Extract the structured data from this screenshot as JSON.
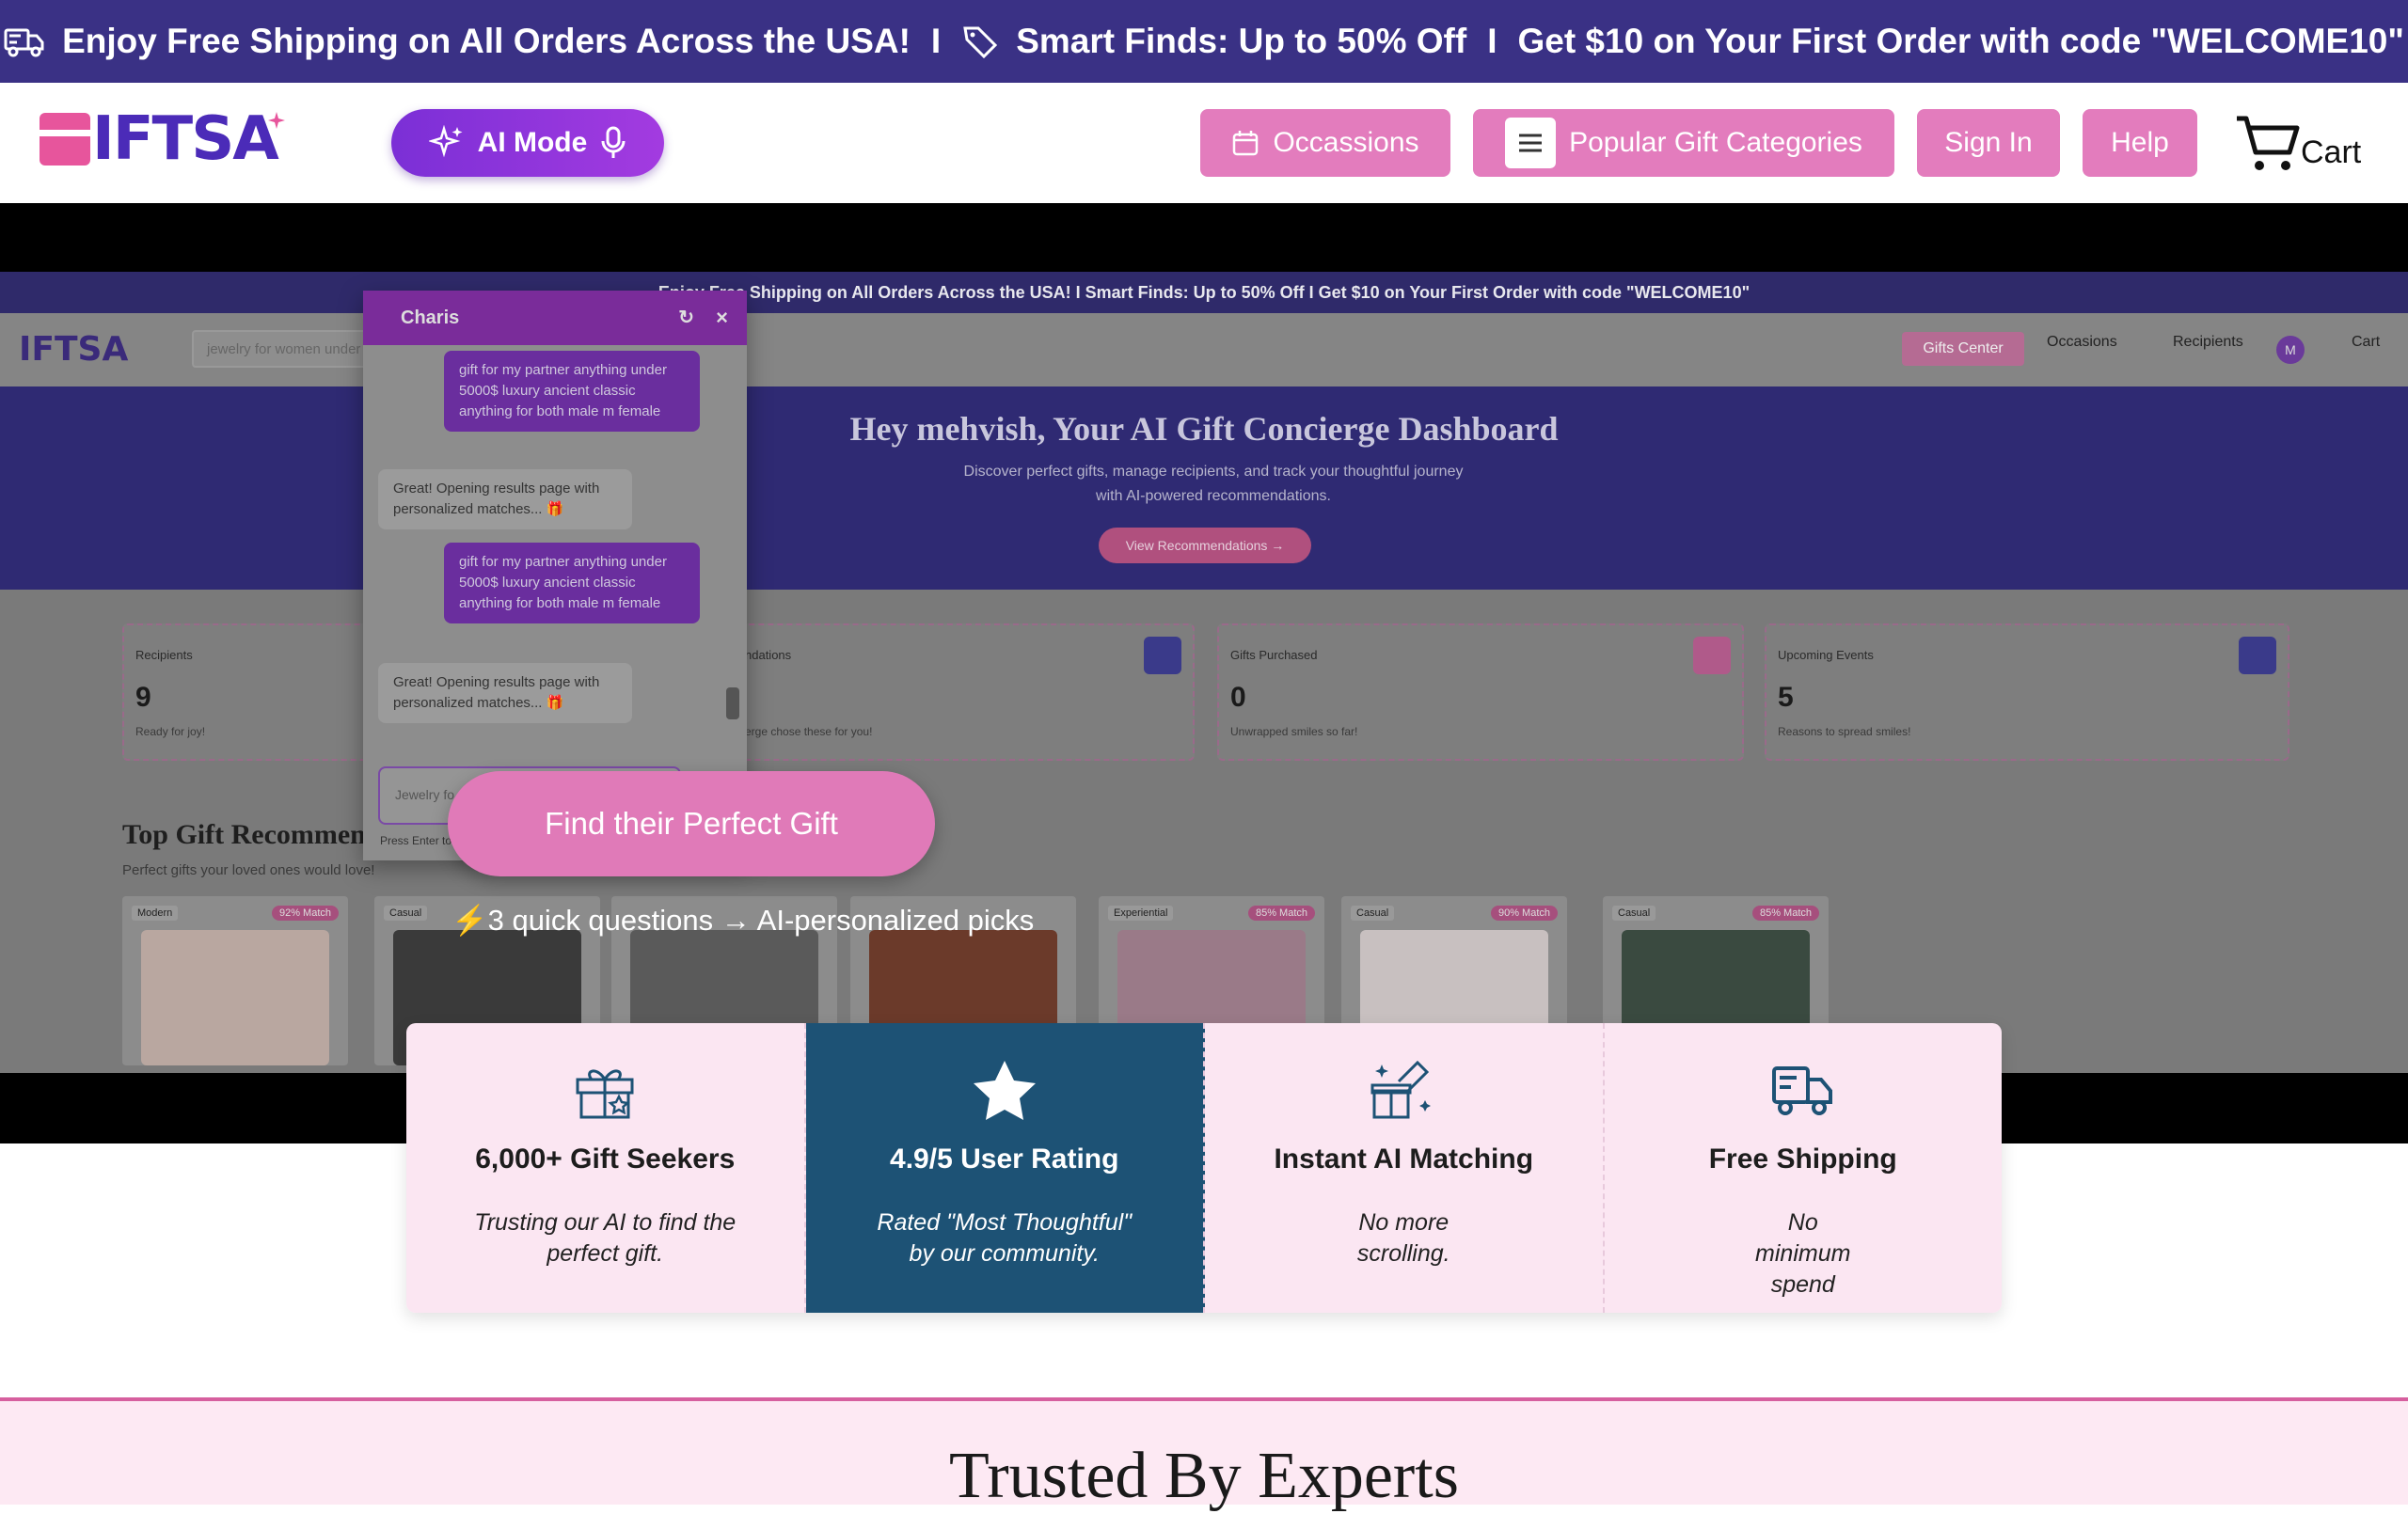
{
  "promo": {
    "shipping": "Enjoy Free Shipping on All Orders Across the USA!",
    "sep": "I",
    "smart": "Smart Finds: Up to 50% Off",
    "welcome": "Get $10 on Your First Order with code \"WELCOME10\""
  },
  "header": {
    "logo_text": "IFTSA",
    "ai_mode": "AI Mode",
    "occasions": "Occassions",
    "categories": "Popular Gift Categories",
    "sign_in": "Sign In",
    "help": "Help",
    "cart": "Cart"
  },
  "preview": {
    "promo": "Enjoy Free Shipping on All Orders Across the USA! I Smart Finds: Up to 50% Off I Get $10 on Your First Order with code \"WELCOME10\"",
    "logo": "IFTSA",
    "search_placeholder": "jewelry for women under 2",
    "nav": {
      "gifts_center": "Gifts Center",
      "occasions": "Occasions",
      "recipients": "Recipients",
      "avatar": "M",
      "cart": "Cart"
    },
    "banner_title": "Hey mehvish, Your AI Gift Concierge Dashboard",
    "banner_sub": "Discover perfect gifts, manage recipients, and track your thoughtful journey with AI-powered recommendations.",
    "banner_cta": "View Recommendations →",
    "cards": [
      {
        "label": "Recipients",
        "value": "9",
        "sub": "Ready for joy!"
      },
      {
        "label": "ndations",
        "value": "",
        "sub": "erge chose these for you!"
      },
      {
        "label": "Gifts Purchased",
        "value": "0",
        "sub": "Unwrapped smiles so far!"
      },
      {
        "label": "Upcoming Events",
        "value": "5",
        "sub": "Reasons to spread smiles!"
      }
    ],
    "top_title": "Top Gift Recommend",
    "top_sub": "Perfect gifts your loved ones would love!",
    "products": [
      {
        "tag": "Modern",
        "match": "92% Match"
      },
      {
        "tag": "Casual",
        "match": ""
      },
      {
        "tag": "",
        "match": ""
      },
      {
        "tag": "",
        "match": ""
      },
      {
        "tag": "Experiential",
        "match": "85% Match"
      },
      {
        "tag": "Casual",
        "match": "90% Match"
      },
      {
        "tag": "Casual",
        "match": "85% Match"
      }
    ],
    "product_colors": [
      "#b9a7a0",
      "#3a3a3a",
      "#5a5a5a",
      "#6b3a2a",
      "#9a7a88",
      "#c8c0c0",
      "#3a4a40"
    ]
  },
  "chat": {
    "title": "Charis",
    "messages": [
      {
        "role": "user",
        "text": "gift for my partner anything under 5000$ luxury ancient classic anything for both male m female"
      },
      {
        "role": "bot",
        "text": "Great! Opening results page with personalized matches... 🎁"
      },
      {
        "role": "user",
        "text": "gift for my partner anything under 5000$ luxury ancient classic anything for both male m female"
      },
      {
        "role": "bot",
        "text": "Great! Opening results page with personalized matches... 🎁"
      }
    ],
    "input_placeholder": "Jewelry fo",
    "hint": "Press Enter to"
  },
  "hero": {
    "cta": "Find their Perfect Gift",
    "quick": "⚡3 quick questions → AI-personalized picks"
  },
  "features": [
    {
      "icon": "gift-icon",
      "title": "6,000+ Gift Seekers",
      "desc": "Trusting our AI to find the perfect gift."
    },
    {
      "icon": "star-icon",
      "title": "4.9/5 User Rating",
      "desc": "Rated \"Most Thoughtful\" by our community."
    },
    {
      "icon": "sparkle-gift-icon",
      "title": "Instant AI Matching",
      "desc": "No more scrolling."
    },
    {
      "icon": "truck-icon",
      "title": "Free Shipping",
      "desc": "No minimum spend"
    }
  ],
  "trusted": {
    "title": "Trusted By Experts"
  },
  "colors": {
    "promo_bg": "#3a3185",
    "brand_pink": "#e37cbd",
    "brand_purple": "#4b2bb8",
    "feature_active": "#1d5275"
  }
}
